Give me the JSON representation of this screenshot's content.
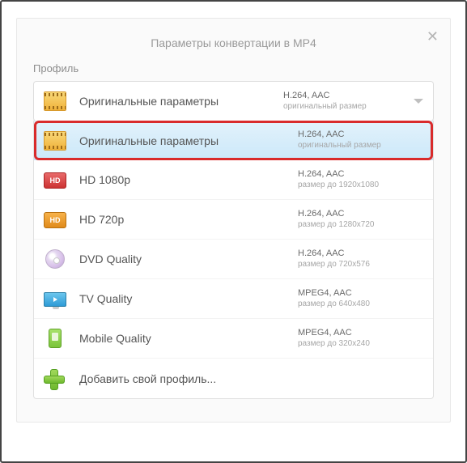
{
  "dialog": {
    "title": "Параметры конвертации в MP4",
    "close_icon": "✕"
  },
  "profile": {
    "label": "Профиль",
    "selected": {
      "name": "Оригинальные параметры",
      "codec": "H.264, AAC",
      "size": "оригинальный размер"
    },
    "options": [
      {
        "name": "Оригинальные параметры",
        "codec": "H.264, AAC",
        "size": "оригинальный размер",
        "icon": "film",
        "highlighted": true
      },
      {
        "name": "HD 1080p",
        "codec": "H.264, AAC",
        "size": "размер до 1920x1080",
        "icon": "hd-red"
      },
      {
        "name": "HD 720p",
        "codec": "H.264, AAC",
        "size": "размер до 1280x720",
        "icon": "hd-orange"
      },
      {
        "name": "DVD Quality",
        "codec": "H.264, AAC",
        "size": "размер до 720x576",
        "icon": "disc"
      },
      {
        "name": "TV Quality",
        "codec": "MPEG4, AAC",
        "size": "размер до 640x480",
        "icon": "monitor"
      },
      {
        "name": "Mobile Quality",
        "codec": "MPEG4, AAC",
        "size": "размер до 320x240",
        "icon": "phone"
      },
      {
        "name": "Добавить свой профиль...",
        "codec": "",
        "size": "",
        "icon": "plus"
      }
    ]
  },
  "hd_badge_text": "HD"
}
